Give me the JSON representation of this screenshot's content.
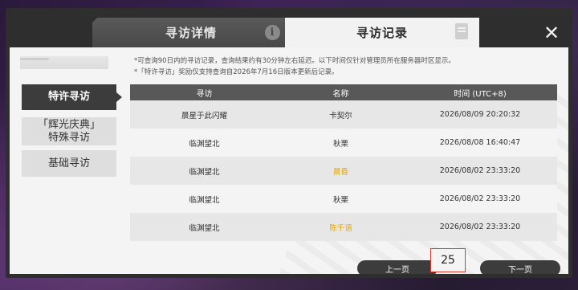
{
  "tabs": {
    "detail_label": "寻访详情",
    "record_label": "寻访记录",
    "detail_icon": "info-icon",
    "record_icon": "document-icon"
  },
  "close_icon": "close-icon",
  "sidebar": {
    "items": [
      {
        "label": "特许寻访",
        "active": true
      },
      {
        "label": "「辉光庆典」\n特殊寻访",
        "active": false
      },
      {
        "label": "基础寻访",
        "active": false
      }
    ]
  },
  "notices": [
    "*可查询90日内的寻访记录，查询结果约有30分钟左右延迟。以下时间仅针对管理员所在服务器时区显示。",
    "*「特许寻访」奖励仅支持查询自2026年7月16日版本更新后记录。"
  ],
  "table": {
    "headers": [
      "寻访",
      "名称",
      "时间 (UTC+8)"
    ],
    "rows": [
      {
        "pool": "晨星于此闪耀",
        "name": "卡契尔",
        "time": "2026/08/09 20:20:32",
        "highlight": false
      },
      {
        "pool": "临渊望北",
        "name": "秋栗",
        "time": "2026/08/08 16:40:47",
        "highlight": false
      },
      {
        "pool": "临渊望北",
        "name": "晨昏",
        "time": "2026/08/02 23:33:20",
        "highlight": true
      },
      {
        "pool": "临渊望北",
        "name": "秋栗",
        "time": "2026/08/02 23:33:20",
        "highlight": false
      },
      {
        "pool": "临渊望北",
        "name": "陈千语",
        "time": "2026/08/02 23:33:20",
        "highlight": true
      }
    ]
  },
  "pagination": {
    "prev_label": "上一页",
    "next_label": "下一页",
    "page": "25"
  },
  "colors": {
    "highlight": "#e5a800",
    "page_border": "#d93a2b",
    "header_bg": "#585858"
  }
}
